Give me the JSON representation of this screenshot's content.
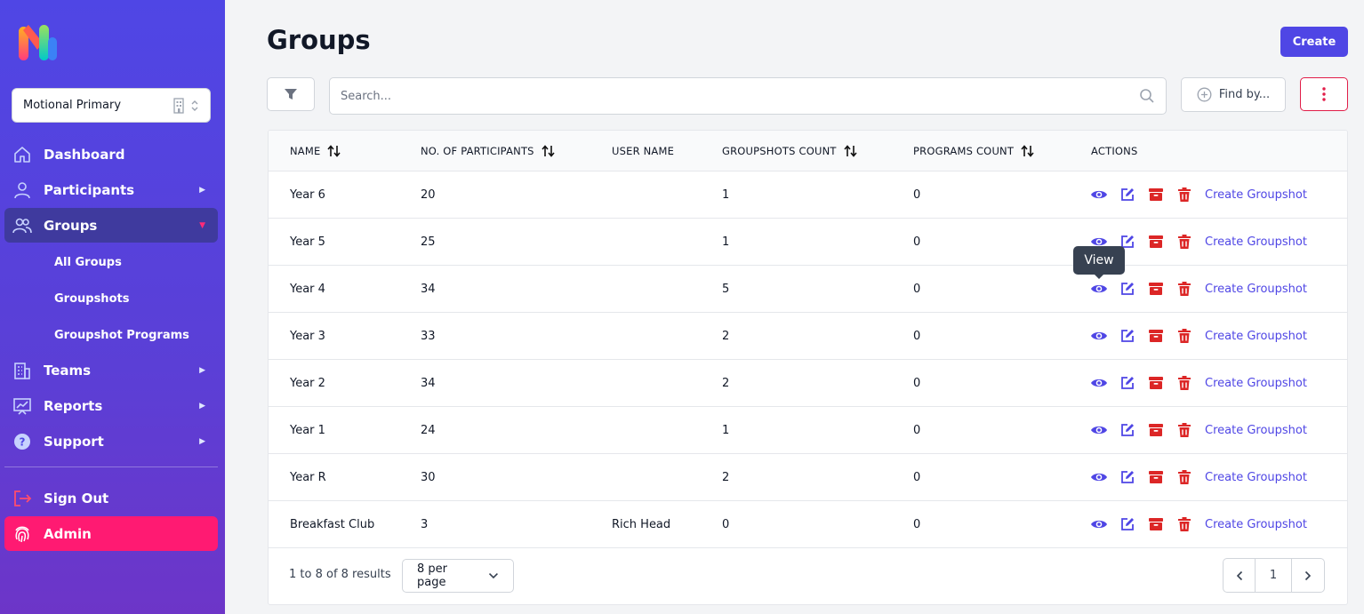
{
  "sidebar": {
    "logo_alt": "M",
    "org": "Motional Primary",
    "nav": [
      {
        "label": "Dashboard",
        "icon": "home-icon"
      },
      {
        "label": "Participants",
        "icon": "user-icon"
      },
      {
        "label": "Groups",
        "icon": "users-icon"
      },
      {
        "label": "Teams",
        "icon": "building-icon"
      },
      {
        "label": "Reports",
        "icon": "chart-icon"
      },
      {
        "label": "Support",
        "icon": "help-icon"
      },
      {
        "label": "Sign Out",
        "icon": "sign-out-icon"
      },
      {
        "label": "Admin",
        "icon": "fingerprint-icon"
      }
    ],
    "sub": [
      "All Groups",
      "Groupshots",
      "Groupshot Programs"
    ]
  },
  "header": {
    "title": "Groups",
    "create_label": "Create"
  },
  "toolbar": {
    "search_placeholder": "Search...",
    "find_label": "Find by..."
  },
  "table": {
    "headers": [
      "NAME",
      "NO. OF PARTICIPANTS",
      "USER NAME",
      "GROUPSHOTS COUNT",
      "PROGRAMS COUNT",
      "ACTIONS"
    ],
    "action_link": "Create Groupshot",
    "rows": [
      {
        "name": "Year 6",
        "participants": "20",
        "user": "",
        "groupshots": "1",
        "programs": "0"
      },
      {
        "name": "Year 5",
        "participants": "25",
        "user": "",
        "groupshots": "1",
        "programs": "0"
      },
      {
        "name": "Year 4",
        "participants": "34",
        "user": "",
        "groupshots": "5",
        "programs": "0"
      },
      {
        "name": "Year 3",
        "participants": "33",
        "user": "",
        "groupshots": "2",
        "programs": "0"
      },
      {
        "name": "Year 2",
        "participants": "34",
        "user": "",
        "groupshots": "2",
        "programs": "0"
      },
      {
        "name": "Year 1",
        "participants": "24",
        "user": "",
        "groupshots": "1",
        "programs": "0"
      },
      {
        "name": "Year R",
        "participants": "30",
        "user": "",
        "groupshots": "2",
        "programs": "0"
      },
      {
        "name": "Breakfast Club",
        "participants": "3",
        "user": "Rich Head",
        "groupshots": "0",
        "programs": "0"
      }
    ]
  },
  "tooltip": "View",
  "footer": {
    "results": "1 to 8 of 8 results",
    "per_page": "8 per page",
    "page": "1"
  },
  "colors": {
    "accent": "#4f46e5",
    "danger": "#dc2626",
    "admin": "#ff1a72"
  }
}
